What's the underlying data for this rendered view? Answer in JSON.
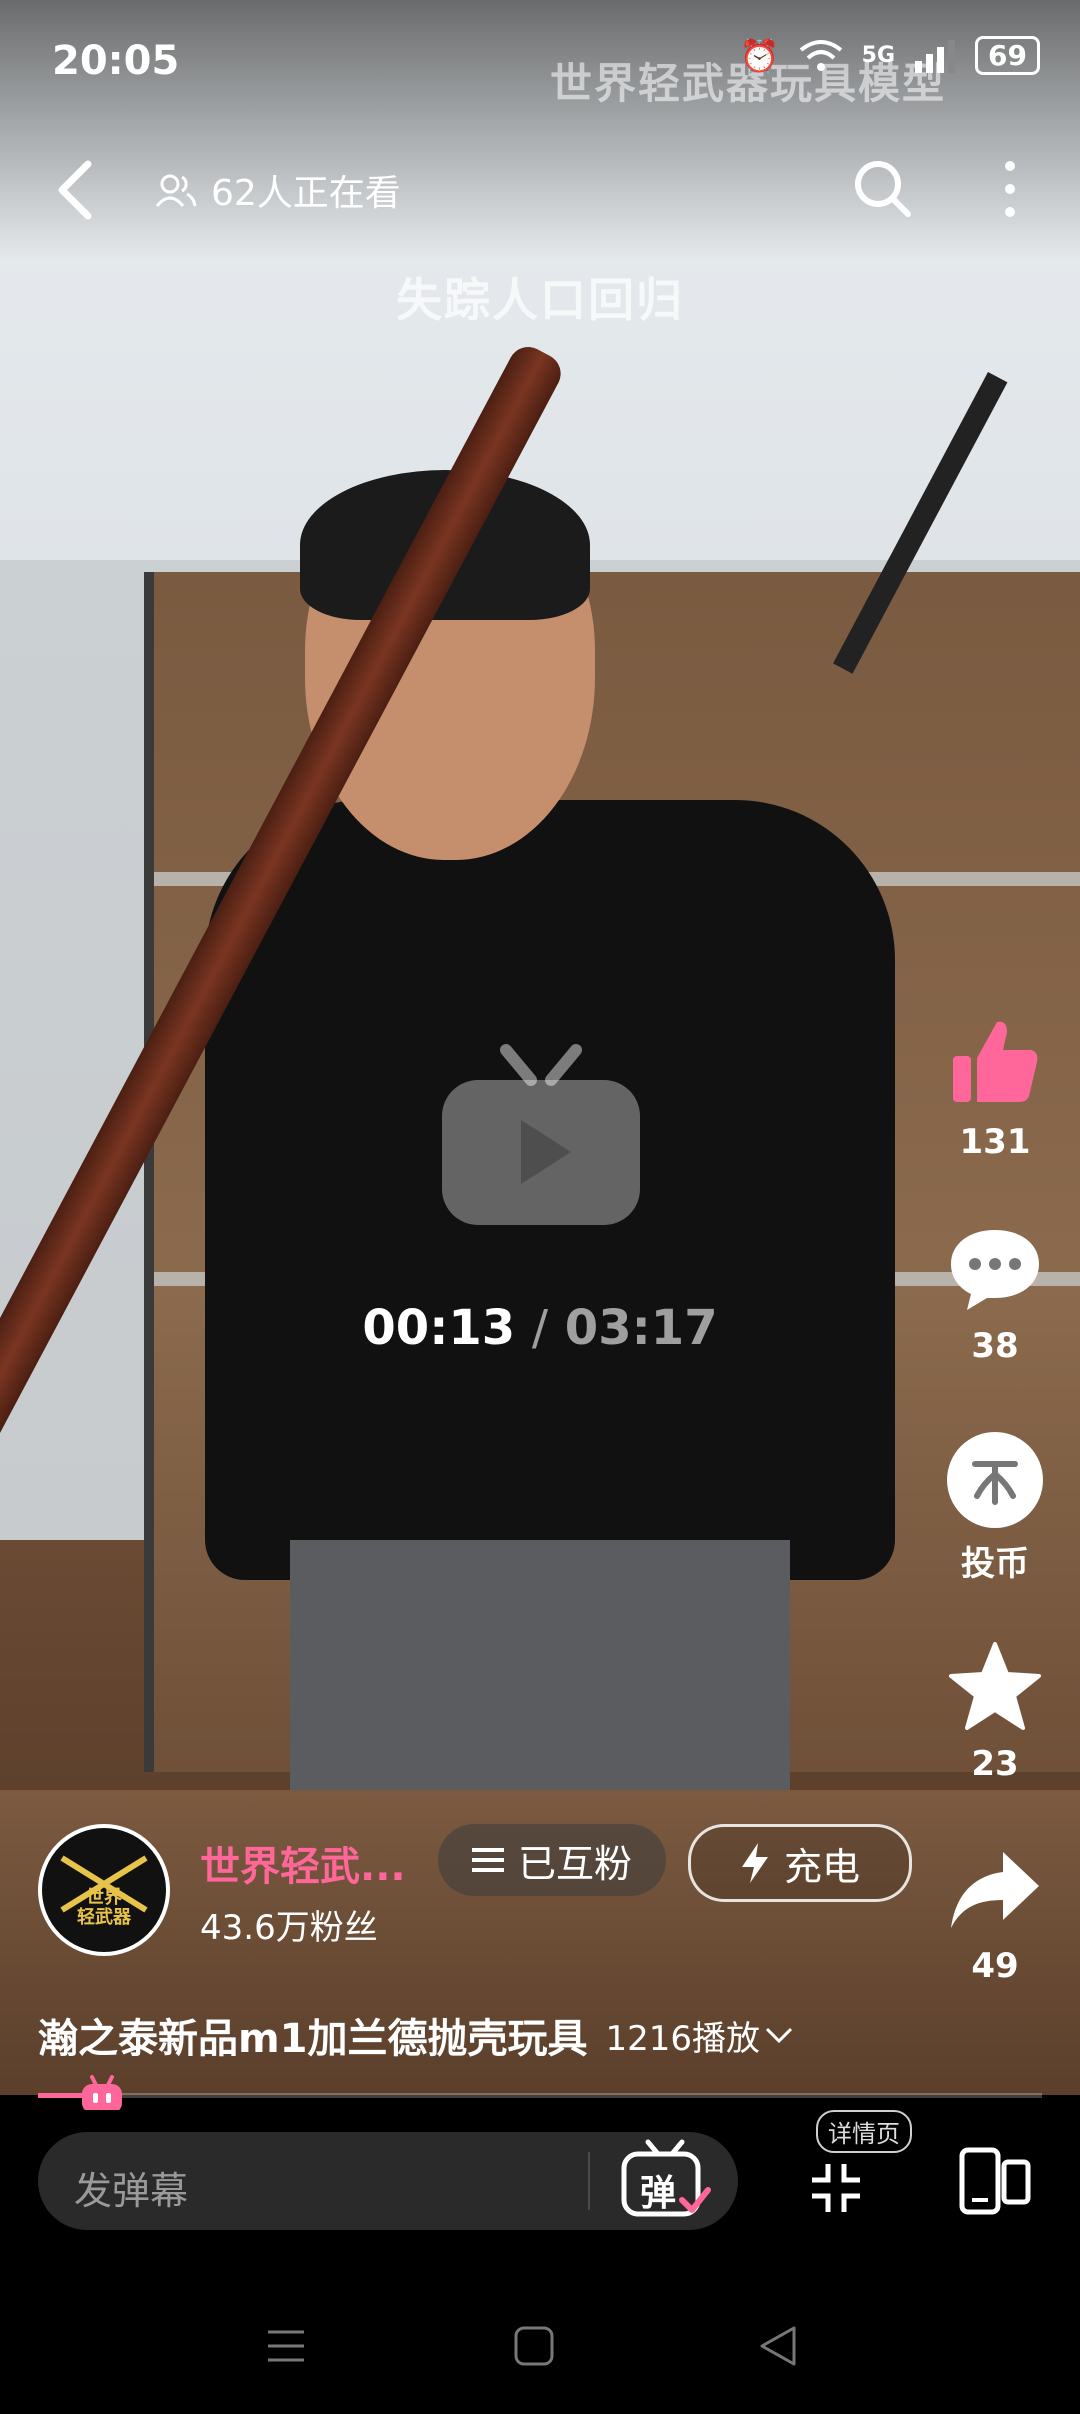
{
  "status_bar": {
    "time": "20:05",
    "network": "5G",
    "battery": "69"
  },
  "watermark": "世界轻武器玩具模型",
  "top_bar": {
    "viewers": "62人正在看"
  },
  "overlay_title": "失踪人口回归",
  "player": {
    "current_time": "00:13",
    "separator": "/",
    "total_time": "03:17",
    "progress": 0.066
  },
  "actions": {
    "like_count": "131",
    "comment_count": "38",
    "coin_label": "投币",
    "favorite_count": "23",
    "share_count": "49"
  },
  "author": {
    "name": "世界轻武...",
    "fans": "43.6万粉丝",
    "avatar_text_line1": "世界",
    "avatar_text_line2": "轻武器",
    "follow_label": "已互粉",
    "charge_label": "充电"
  },
  "video": {
    "title": "瀚之泰新品m1加兰德抛壳玩具",
    "plays": "1216播放"
  },
  "bottom_bar": {
    "danmaku_placeholder": "发弹幕",
    "danmaku_toggle_label": "弹",
    "detail_tip": "详情页"
  },
  "colors": {
    "accent": "#ff6699",
    "like": "#ff6699"
  }
}
